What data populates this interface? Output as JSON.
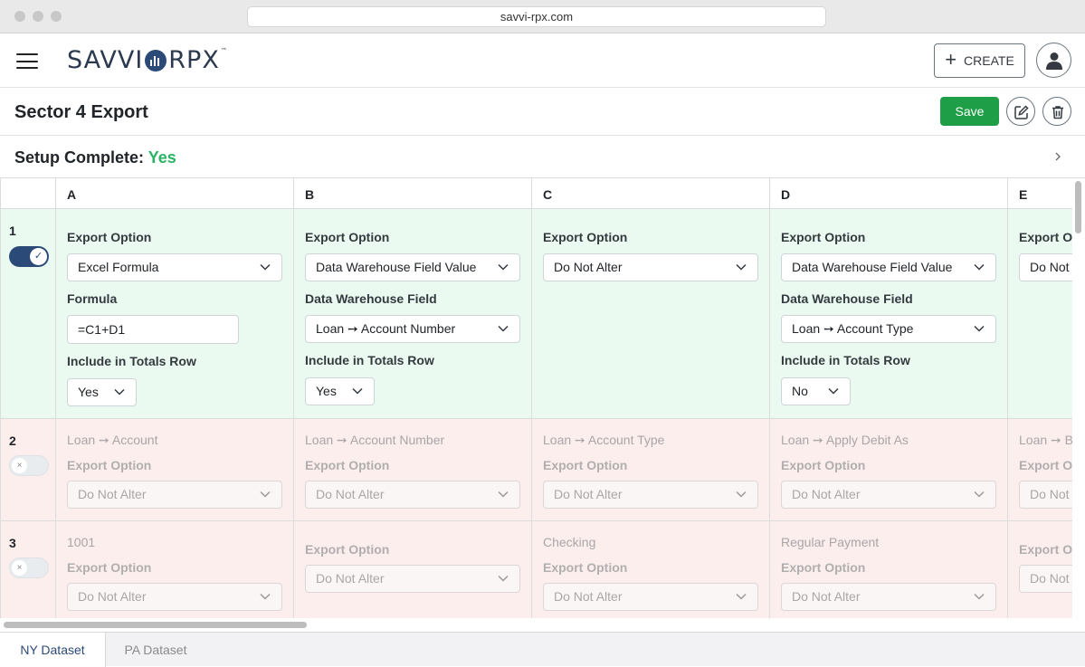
{
  "browser": {
    "url": "savvi-rpx.com"
  },
  "header": {
    "logo_left": "SAVVI",
    "logo_right": "RPX",
    "logo_tm": "™",
    "create_label": "CREATE"
  },
  "page": {
    "title": "Sector 4 Export",
    "save_label": "Save",
    "setup_label": "Setup Complete:",
    "setup_value": "Yes"
  },
  "columns": [
    "A",
    "B",
    "C",
    "D",
    "E"
  ],
  "rows": [
    {
      "number": "1",
      "enabled": true,
      "cells": {
        "A": {
          "export_option_label": "Export Option",
          "export_option": "Excel Formula",
          "formula_label": "Formula",
          "formula": "=C1+D1",
          "totals_label": "Include in Totals Row",
          "totals": "Yes"
        },
        "B": {
          "export_option_label": "Export Option",
          "export_option": "Data Warehouse Field Value",
          "dw_label": "Data Warehouse Field",
          "dw_field": "Loan ➙ Account Number",
          "totals_label": "Include in Totals Row",
          "totals": "Yes"
        },
        "C": {
          "export_option_label": "Export Option",
          "export_option": "Do Not Alter"
        },
        "D": {
          "export_option_label": "Export Option",
          "export_option": "Data Warehouse Field Value",
          "dw_label": "Data Warehouse Field",
          "dw_field": "Loan ➙ Account Type",
          "totals_label": "Include in Totals Row",
          "totals": "No"
        },
        "E": {
          "export_option_label": "Export Option",
          "export_option": "Do Not Alter"
        }
      }
    },
    {
      "number": "2",
      "enabled": false,
      "cells": {
        "A": {
          "value": "Loan ➙ Account",
          "export_option_label": "Export Option",
          "export_option": "Do Not Alter"
        },
        "B": {
          "value": "Loan ➙ Account Number",
          "export_option_label": "Export Option",
          "export_option": "Do Not Alter"
        },
        "C": {
          "value": "Loan ➙ Account Type",
          "export_option_label": "Export Option",
          "export_option": "Do Not Alter"
        },
        "D": {
          "value": "Loan ➙ Apply Debit As",
          "export_option_label": "Export Option",
          "export_option": "Do Not Alter"
        },
        "E": {
          "value": "Loan ➙ B",
          "export_option_label": "Export Option",
          "export_option": "Do Not Alter"
        }
      }
    },
    {
      "number": "3",
      "enabled": false,
      "cells": {
        "A": {
          "value": "1001",
          "export_option_label": "Export Option",
          "export_option": "Do Not Alter"
        },
        "B": {
          "value": "",
          "export_option_label": "Export Option",
          "export_option": "Do Not Alter"
        },
        "C": {
          "value": "Checking",
          "export_option_label": "Export Option",
          "export_option": "Do Not Alter"
        },
        "D": {
          "value": "Regular Payment",
          "export_option_label": "Export Option",
          "export_option": "Do Not Alter"
        },
        "E": {
          "value": "",
          "export_option_label": "Export Option",
          "export_option": "Do Not Alter"
        }
      }
    }
  ],
  "tabs": [
    {
      "label": "NY Dataset",
      "active": true
    },
    {
      "label": "PA Dataset",
      "active": false
    }
  ],
  "colors": {
    "brand": "#2b4a78",
    "success": "#1e9e46",
    "enabled_row_bg": "#eafaf0",
    "disabled_row_bg": "#fdeeee"
  }
}
